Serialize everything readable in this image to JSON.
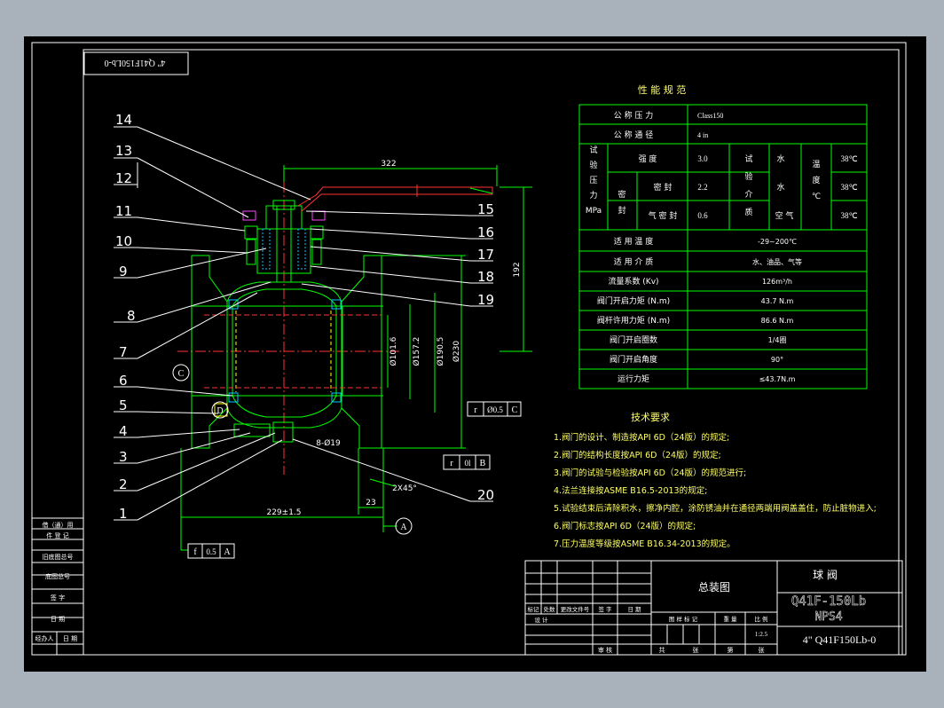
{
  "colors": {
    "frame": "#ffffff",
    "line": "#00ff00",
    "leader": "#ffffff",
    "center": "#ff3333",
    "hidden": "#ffff00",
    "text": "#ffffff",
    "accent_yellow": "#ffff66",
    "cyan": "#00c8ff"
  },
  "mirror_code": "4\" Q41F150Lb-0",
  "parts": [
    "14",
    "13",
    "12",
    "11",
    "10",
    "9",
    "8",
    "7",
    "6",
    "5",
    "4",
    "3",
    "2",
    "1",
    "15",
    "16",
    "17",
    "18",
    "19",
    "20"
  ],
  "dims": {
    "top": "322",
    "height": "192",
    "port": "Ø101.6",
    "d1": "Ø157.2",
    "d2": "Ø190.5",
    "d3": "Ø230",
    "bolts": "8-Ø19",
    "chamfer": "2X45°",
    "gap": "23",
    "length": "229±1.5",
    "tol_c": "r",
    "tol_c_val": "Ø0.5",
    "tol_c_ref": "C",
    "tol_b": "r",
    "tol_b_val": "0l",
    "tol_b_ref": "B",
    "tol_f": "f",
    "tol_f_val": "0.5",
    "tol_f_ref": "A",
    "datum_a": "A",
    "datum_b": "D",
    "datum_c": "C"
  },
  "spec": {
    "title": "性 能 规 范",
    "rows1": [
      {
        "label": "公 称 压 力",
        "value": "Class150"
      },
      {
        "label": "公 称 通 径",
        "value": "4 in"
      }
    ],
    "test": {
      "label": "试\n验\n压\n力\nMPa",
      "strength": "强 度",
      "seal": "密\n封",
      "seal_seat": "密 封",
      "seal_air": "气 密 封",
      "v_strength": "3.0",
      "v_seal": "2.2",
      "v_air": "0.6",
      "medium_label": "试\n验\n介\n质",
      "m1": "水",
      "m2": "水",
      "m3": "空 气",
      "temp_label": "温\n度\n℃",
      "t1": "38℃",
      "t2": "38℃",
      "t3": "38℃"
    },
    "rows2": [
      {
        "label": "适 用 温 度",
        "value": "-29~200℃"
      },
      {
        "label": "适 用 介 质",
        "value": "水、油品、气等"
      },
      {
        "label": "流量系数 (Kv)",
        "value": "126m³/h"
      },
      {
        "label": "阀门开启力矩 (N.m)",
        "value": "43.7 N.m"
      },
      {
        "label": "阀杆许用力矩 (N.m)",
        "value": "86.6 N.m"
      },
      {
        "label": "阀门开启圈数",
        "value": "1/4圈"
      },
      {
        "label": "阀门开启角度",
        "value": "90°"
      },
      {
        "label": "运行力矩",
        "value": "≤43.7N.m"
      }
    ]
  },
  "notes": {
    "title": "技术要求",
    "items": [
      "1.阀门的设计、制造按API 6D（24版）的规定;",
      "2.阀门的结构长度按API 6D（24版）的规定;",
      "3.阀门的试验与检验按API 6D（24版）的规范进行;",
      "4.法兰连接按ASME B16.5-2013的规定;",
      "5.试验结束后清除积水，擦净内腔，涂防锈油并在通径两端用阀盖盖住，防止脏物进入;",
      "6.阀门标志按API 6D（24版）的规定;",
      "7.压力温度等级按ASME B16.34-2013的规定。"
    ]
  },
  "leftblock": [
    "借（通）用",
    "件 登 记",
    "旧底图总号",
    "底图总号",
    "签 字",
    "日 期",
    "经办人",
    "日 期"
  ],
  "titleblock": {
    "assembly": "总装图",
    "name": "球 阀",
    "model": "Q41F-150Lb",
    "nps": "NPS4",
    "code": "4\" Q41F150Lb-0",
    "scale": "1:2.5",
    "headers": [
      "标记",
      "处数",
      "更改文件号",
      "签 字",
      "日 期"
    ],
    "sub": [
      "设 计"
    ],
    "stage_labels": [
      "图 样 标 记",
      "重 量",
      "比 例"
    ],
    "bottom": [
      "共",
      "张",
      "第",
      "张"
    ],
    "audit": "审 核"
  }
}
